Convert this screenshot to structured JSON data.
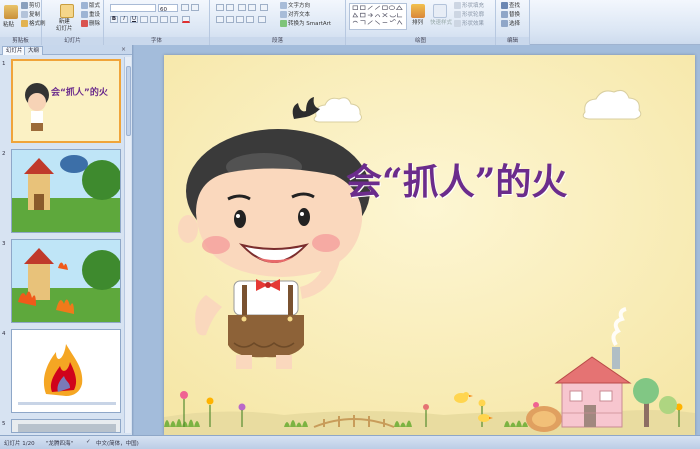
{
  "ribbon": {
    "clipboard": {
      "paste": "粘贴",
      "cut": "剪切",
      "copy": "复制",
      "format_painter": "格式刷",
      "label": "剪贴板"
    },
    "slides": {
      "new_slide": "新建\n幻灯片",
      "layout": "版式",
      "reset": "重设",
      "delete": "删除",
      "label": "幻灯片"
    },
    "font": {
      "font_size": "60",
      "label": "字体"
    },
    "paragraph": {
      "text_direction": "文字方向",
      "align_text": "对齐文本",
      "convert_smartart": "转换为 SmartArt",
      "label": "段落"
    },
    "drawing": {
      "arrange": "排列",
      "quick_styles": "快速样式",
      "shape_fill": "形状填充",
      "shape_outline": "形状轮廓",
      "shape_effects": "形状效果",
      "label": "绘图"
    },
    "editing": {
      "find": "查找",
      "replace": "替换",
      "select": "选择",
      "label": "编辑"
    }
  },
  "pane": {
    "tab_slides": "幻灯片",
    "tab_outline": "大纲",
    "close": "×"
  },
  "thumbnails": [
    {
      "num": "1",
      "title": "会“抓人”的火"
    },
    {
      "num": "2"
    },
    {
      "num": "3"
    },
    {
      "num": "4"
    },
    {
      "num": "5"
    }
  ],
  "slide": {
    "title": "会“抓人”的火"
  },
  "status": {
    "slide_info": "幻灯片 1/20",
    "theme": "\"龙腾四海\"",
    "language": "中文(简体，中国)"
  }
}
